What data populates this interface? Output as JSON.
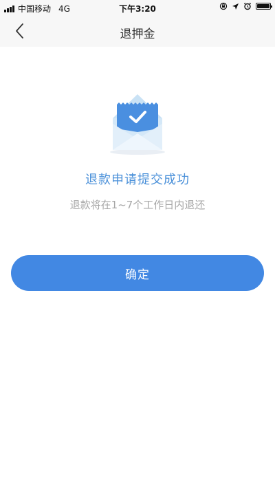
{
  "status_bar": {
    "carrier": "中国移动",
    "network": "4G",
    "time": "下午3:20",
    "icons": [
      "signal-icon",
      "rotation-lock-icon",
      "location-icon",
      "alarm-icon",
      "battery-icon"
    ]
  },
  "nav": {
    "title": "退押金",
    "back_icon": "chevron-left-icon"
  },
  "content": {
    "illustration_icon": "envelope-check-icon",
    "success_title": "退款申请提交成功",
    "success_subtitle": "退款将在1~7个工作日内退还"
  },
  "actions": {
    "confirm_label": "确定"
  },
  "colors": {
    "accent": "#4288e3",
    "title_text": "#4a90d9",
    "sub_text": "#a6a6a6",
    "bar_background": "#f7f7f7"
  }
}
